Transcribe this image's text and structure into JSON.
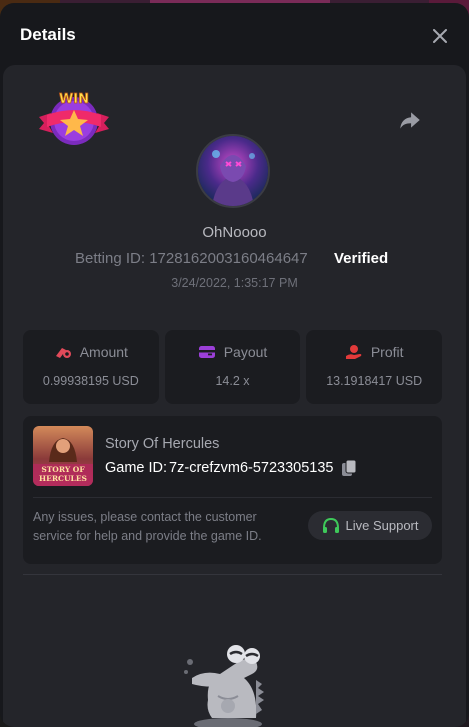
{
  "modal": {
    "title": "Details",
    "close_label": "close"
  },
  "bet": {
    "badge_text": "WIN",
    "username": "OhNoooo",
    "betting_id_label": "Betting ID:",
    "betting_id": "1728162003160464647",
    "verified_label": "Verified",
    "timestamp": "3/24/2022, 1:35:17 PM"
  },
  "stats": [
    {
      "label": "Amount",
      "value": "0.99938195 USD",
      "icon": "coins-icon",
      "color": "#e24a5a"
    },
    {
      "label": "Payout",
      "value": "14.2 x",
      "icon": "wallet-icon",
      "color": "#9b3fd8"
    },
    {
      "label": "Profit",
      "value": "13.1918417 USD",
      "icon": "hand-coin-icon",
      "color": "#e23a3a"
    }
  ],
  "game": {
    "name": "Story Of Hercules",
    "id_label": "Game ID:",
    "id": "7z-crefzvm6-5723305135",
    "thumb_text_line1": "STORY OF",
    "thumb_text_line2": "HERCULES",
    "help_text": "Any issues, please contact the customer service for help and provide the game ID.",
    "support_label": "Live Support"
  },
  "colors": {
    "accent_green": "#3ec95a",
    "modal_bg": "#17181c",
    "content_bg": "#24252a"
  }
}
